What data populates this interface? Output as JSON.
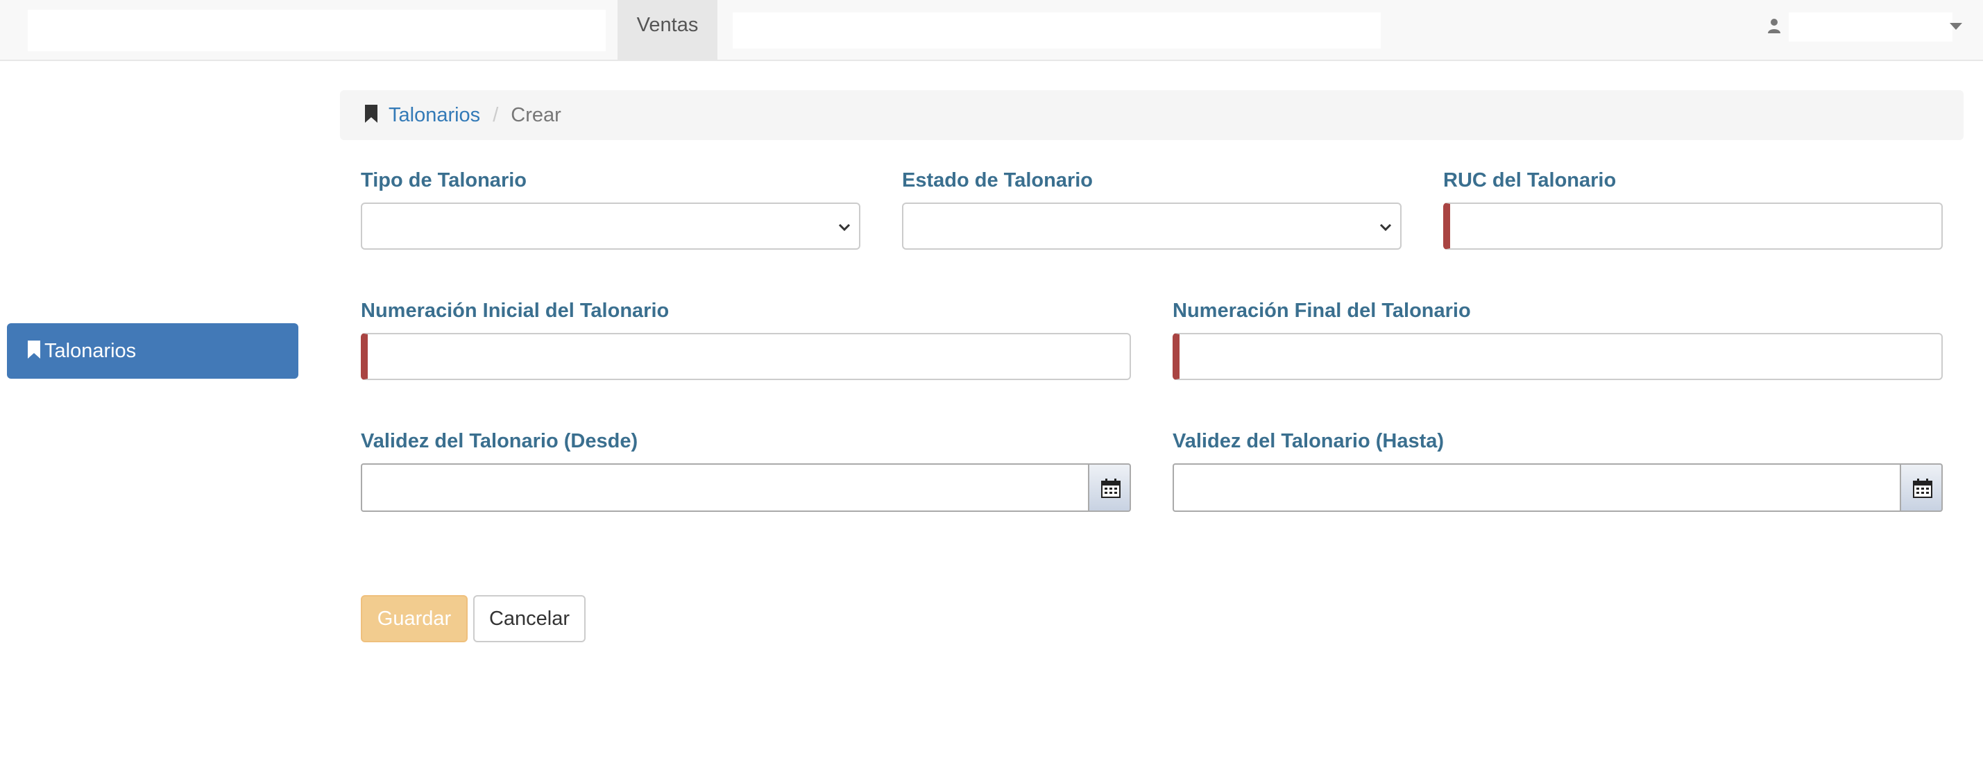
{
  "navbar": {
    "tab_label": "Ventas"
  },
  "icons": {
    "user": "user-icon",
    "caret": "caret-down-icon",
    "bookmark": "bookmark-icon",
    "chevron": "chevron-down-icon",
    "calendar": "calendar-icon"
  },
  "sidebar": {
    "items": [
      {
        "label": "Talonarios"
      }
    ]
  },
  "breadcrumb": {
    "link": "Talonarios",
    "separator": "/",
    "current": "Crear"
  },
  "form": {
    "tipo": {
      "label": "Tipo de Talonario",
      "value": ""
    },
    "estado": {
      "label": "Estado de Talonario",
      "value": ""
    },
    "ruc": {
      "label": "RUC del Talonario",
      "value": ""
    },
    "num_inicial": {
      "label": "Numeración Inicial del Talonario",
      "value": ""
    },
    "num_final": {
      "label": "Numeración Final del Talonario",
      "value": ""
    },
    "validez_desde": {
      "label": "Validez del Talonario (Desde)",
      "value": ""
    },
    "validez_hasta": {
      "label": "Validez del Talonario (Hasta)",
      "value": ""
    }
  },
  "buttons": {
    "save": "Guardar",
    "cancel": "Cancelar"
  },
  "colors": {
    "primary": "#4279b7",
    "link": "#337ab7",
    "label": "#3a6f8f",
    "required_marker": "#a94442",
    "save_button": "#f2cc8f"
  }
}
